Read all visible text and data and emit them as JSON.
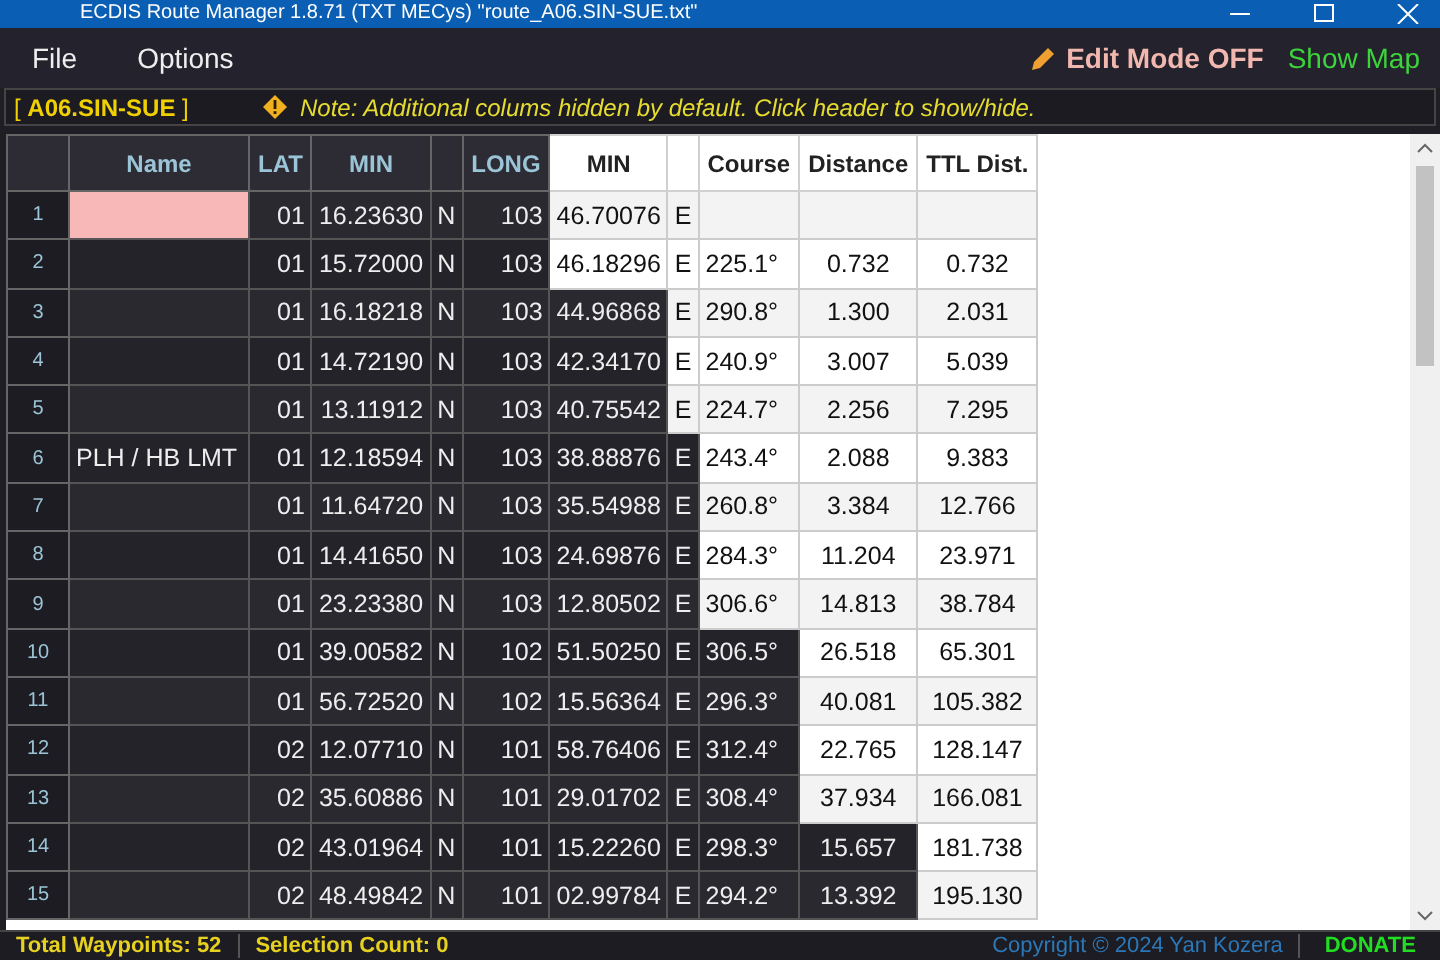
{
  "window": {
    "title": "ECDIS Route Manager 1.8.71 (TXT MECys)  \"route_A06.SIN-SUE.txt\""
  },
  "menu": [
    "File",
    "Options"
  ],
  "edit_mode": {
    "label": "Edit Mode OFF"
  },
  "show_map": {
    "label": "Show Map"
  },
  "info_bar": {
    "route": "[ **A06.SIN-SUE** ]",
    "note": "Note: Additional colums hidden by default. Click header to show/hide."
  },
  "table": {
    "columns": [
      "",
      "Name",
      "LAT",
      "MIN",
      "",
      "LONG",
      "MIN",
      "",
      "Course",
      "Distance",
      "TTL Dist."
    ],
    "rows": [
      {
        "name_highlighted": true,
        "cells": [
          "1",
          "",
          "01",
          "16.23630",
          "N",
          "103",
          "46.70076",
          "E",
          "",
          "",
          ""
        ]
      },
      {
        "name_highlighted": false,
        "cells": [
          "2",
          "",
          "01",
          "15.72000",
          "N",
          "103",
          "46.18296",
          "E",
          "225.1°",
          "0.732",
          "0.732"
        ]
      },
      {
        "name_highlighted": false,
        "cells": [
          "3",
          "",
          "01",
          "16.18218",
          "N",
          "103",
          "44.96868",
          "E",
          "290.8°",
          "1.300",
          "2.031"
        ]
      },
      {
        "name_highlighted": false,
        "cells": [
          "4",
          "",
          "01",
          "14.72190",
          "N",
          "103",
          "42.34170",
          "E",
          "240.9°",
          "3.007",
          "5.039"
        ]
      },
      {
        "name_highlighted": false,
        "cells": [
          "5",
          "",
          "01",
          "13.11912",
          "N",
          "103",
          "40.75542",
          "E",
          "224.7°",
          "2.256",
          "7.295"
        ]
      },
      {
        "name_highlighted": false,
        "cells": [
          "6",
          "PLH / HB LMT",
          "01",
          "12.18594",
          "N",
          "103",
          "38.88876",
          "E",
          "243.4°",
          "2.088",
          "9.383"
        ]
      },
      {
        "name_highlighted": false,
        "cells": [
          "7",
          "",
          "01",
          "11.64720",
          "N",
          "103",
          "35.54988",
          "E",
          "260.8°",
          "3.384",
          "12.766"
        ]
      },
      {
        "name_highlighted": false,
        "cells": [
          "8",
          "",
          "01",
          "14.41650",
          "N",
          "103",
          "24.69876",
          "E",
          "284.3°",
          "11.204",
          "23.971"
        ]
      },
      {
        "name_highlighted": false,
        "cells": [
          "9",
          "",
          "01",
          "23.23380",
          "N",
          "103",
          "12.80502",
          "E",
          "306.6°",
          "14.813",
          "38.784"
        ]
      },
      {
        "name_highlighted": false,
        "cells": [
          "10",
          "",
          "01",
          "39.00582",
          "N",
          "102",
          "51.50250",
          "E",
          "306.5°",
          "26.518",
          "65.301"
        ]
      },
      {
        "name_highlighted": false,
        "cells": [
          "11",
          "",
          "01",
          "56.72520",
          "N",
          "102",
          "15.56364",
          "E",
          "296.3°",
          "40.081",
          "105.382"
        ]
      },
      {
        "name_highlighted": false,
        "cells": [
          "12",
          "",
          "02",
          "12.07710",
          "N",
          "101",
          "58.76406",
          "E",
          "312.4°",
          "22.765",
          "128.147"
        ]
      },
      {
        "name_highlighted": false,
        "cells": [
          "13",
          "",
          "02",
          "35.60886",
          "N",
          "101",
          "29.01702",
          "E",
          "308.4°",
          "37.934",
          "166.081"
        ]
      },
      {
        "name_highlighted": false,
        "cells": [
          "14",
          "",
          "02",
          "43.01964",
          "N",
          "101",
          "15.22260",
          "E",
          "298.3°",
          "15.657",
          "181.738"
        ]
      },
      {
        "name_highlighted": false,
        "cells": [
          "15",
          "",
          "02",
          "48.49842",
          "N",
          "101",
          "02.99784",
          "E",
          "294.2°",
          "13.392",
          "195.130"
        ]
      }
    ]
  },
  "status_bar": {
    "waypoints": "Total Waypoints: 52",
    "selection": "Selection Count: 0",
    "copyright": "Copyright © 2024 Yan Kozera",
    "donate": "DONATE"
  }
}
